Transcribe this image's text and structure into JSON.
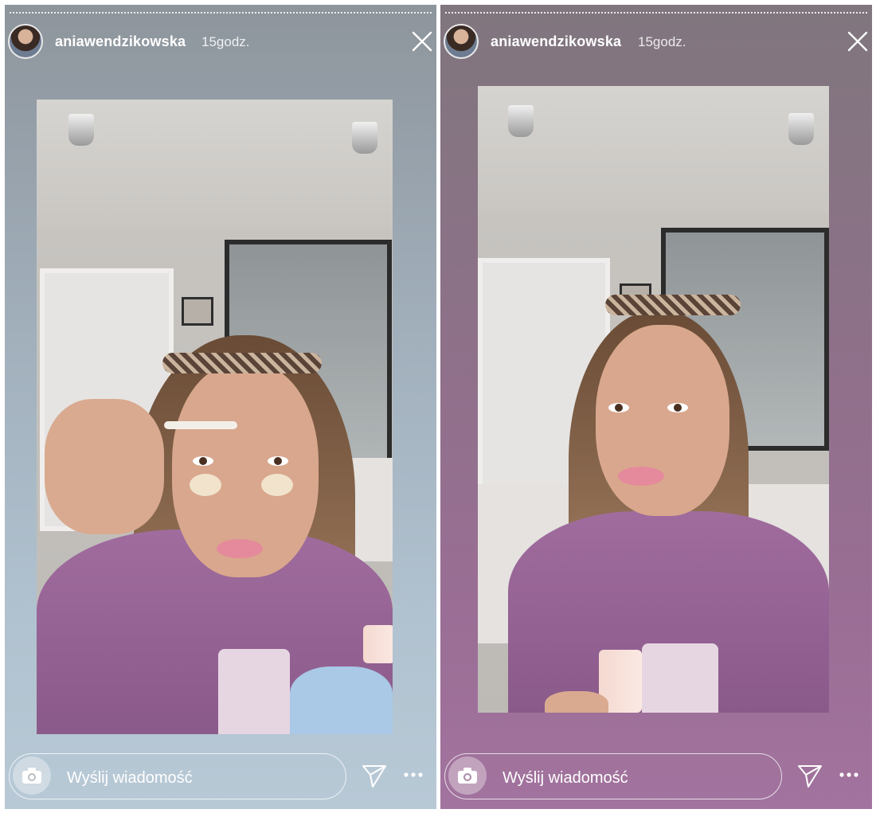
{
  "stories": [
    {
      "username": "aniawendzikowska",
      "time": "15godz.",
      "message_placeholder": "Wyślij wiadomość"
    },
    {
      "username": "aniawendzikowska",
      "time": "15godz.",
      "message_placeholder": "Wyślij wiadomość"
    }
  ],
  "icons": {
    "close": "close-icon",
    "camera": "camera-icon",
    "send": "send-icon",
    "more": "more-icon"
  },
  "colors": {
    "left_story_bg": "#a1afbb",
    "right_story_bg": "#8d7188",
    "text": "#ffffff"
  }
}
